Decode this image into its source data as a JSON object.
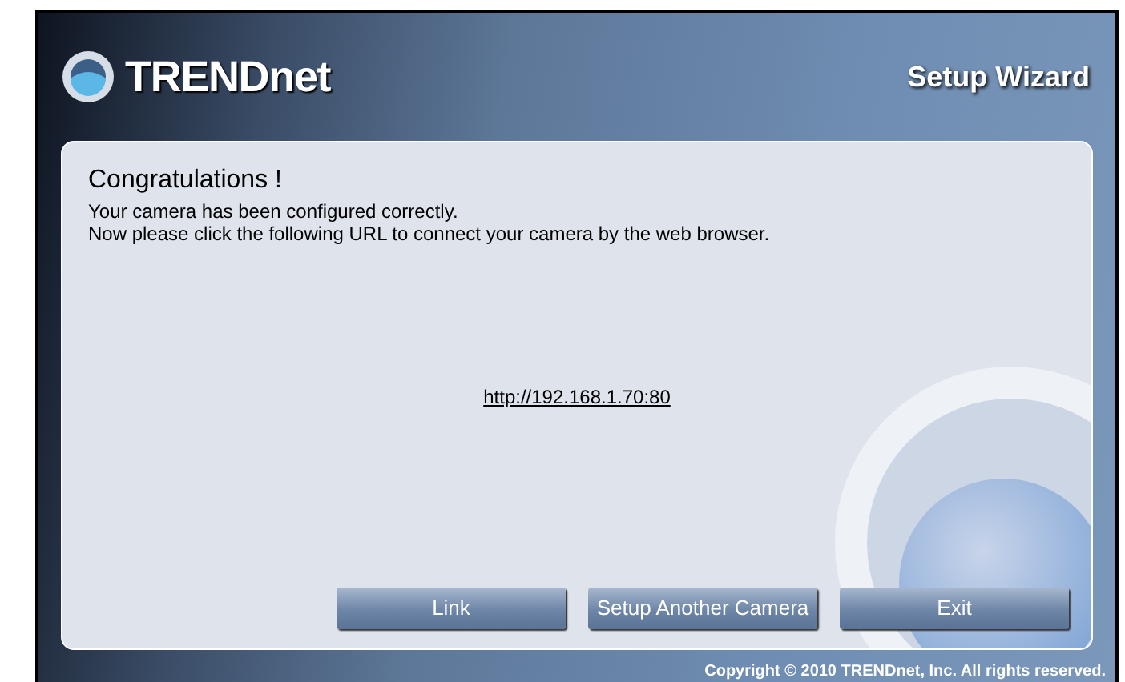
{
  "header": {
    "logo": "TRENDnet",
    "title": "Setup Wizard"
  },
  "panel": {
    "heading": "Congratulations !",
    "lines": [
      "Your camera has been configured correctly.",
      "Now please click the following URL to connect your camera by the web browser."
    ],
    "url": "http://192.168.1.70:80"
  },
  "buttons": [
    "Link",
    "Setup Another Camera",
    "Exit"
  ],
  "footer": "Copyright © 2010 TRENDnet, Inc. All rights reserved."
}
